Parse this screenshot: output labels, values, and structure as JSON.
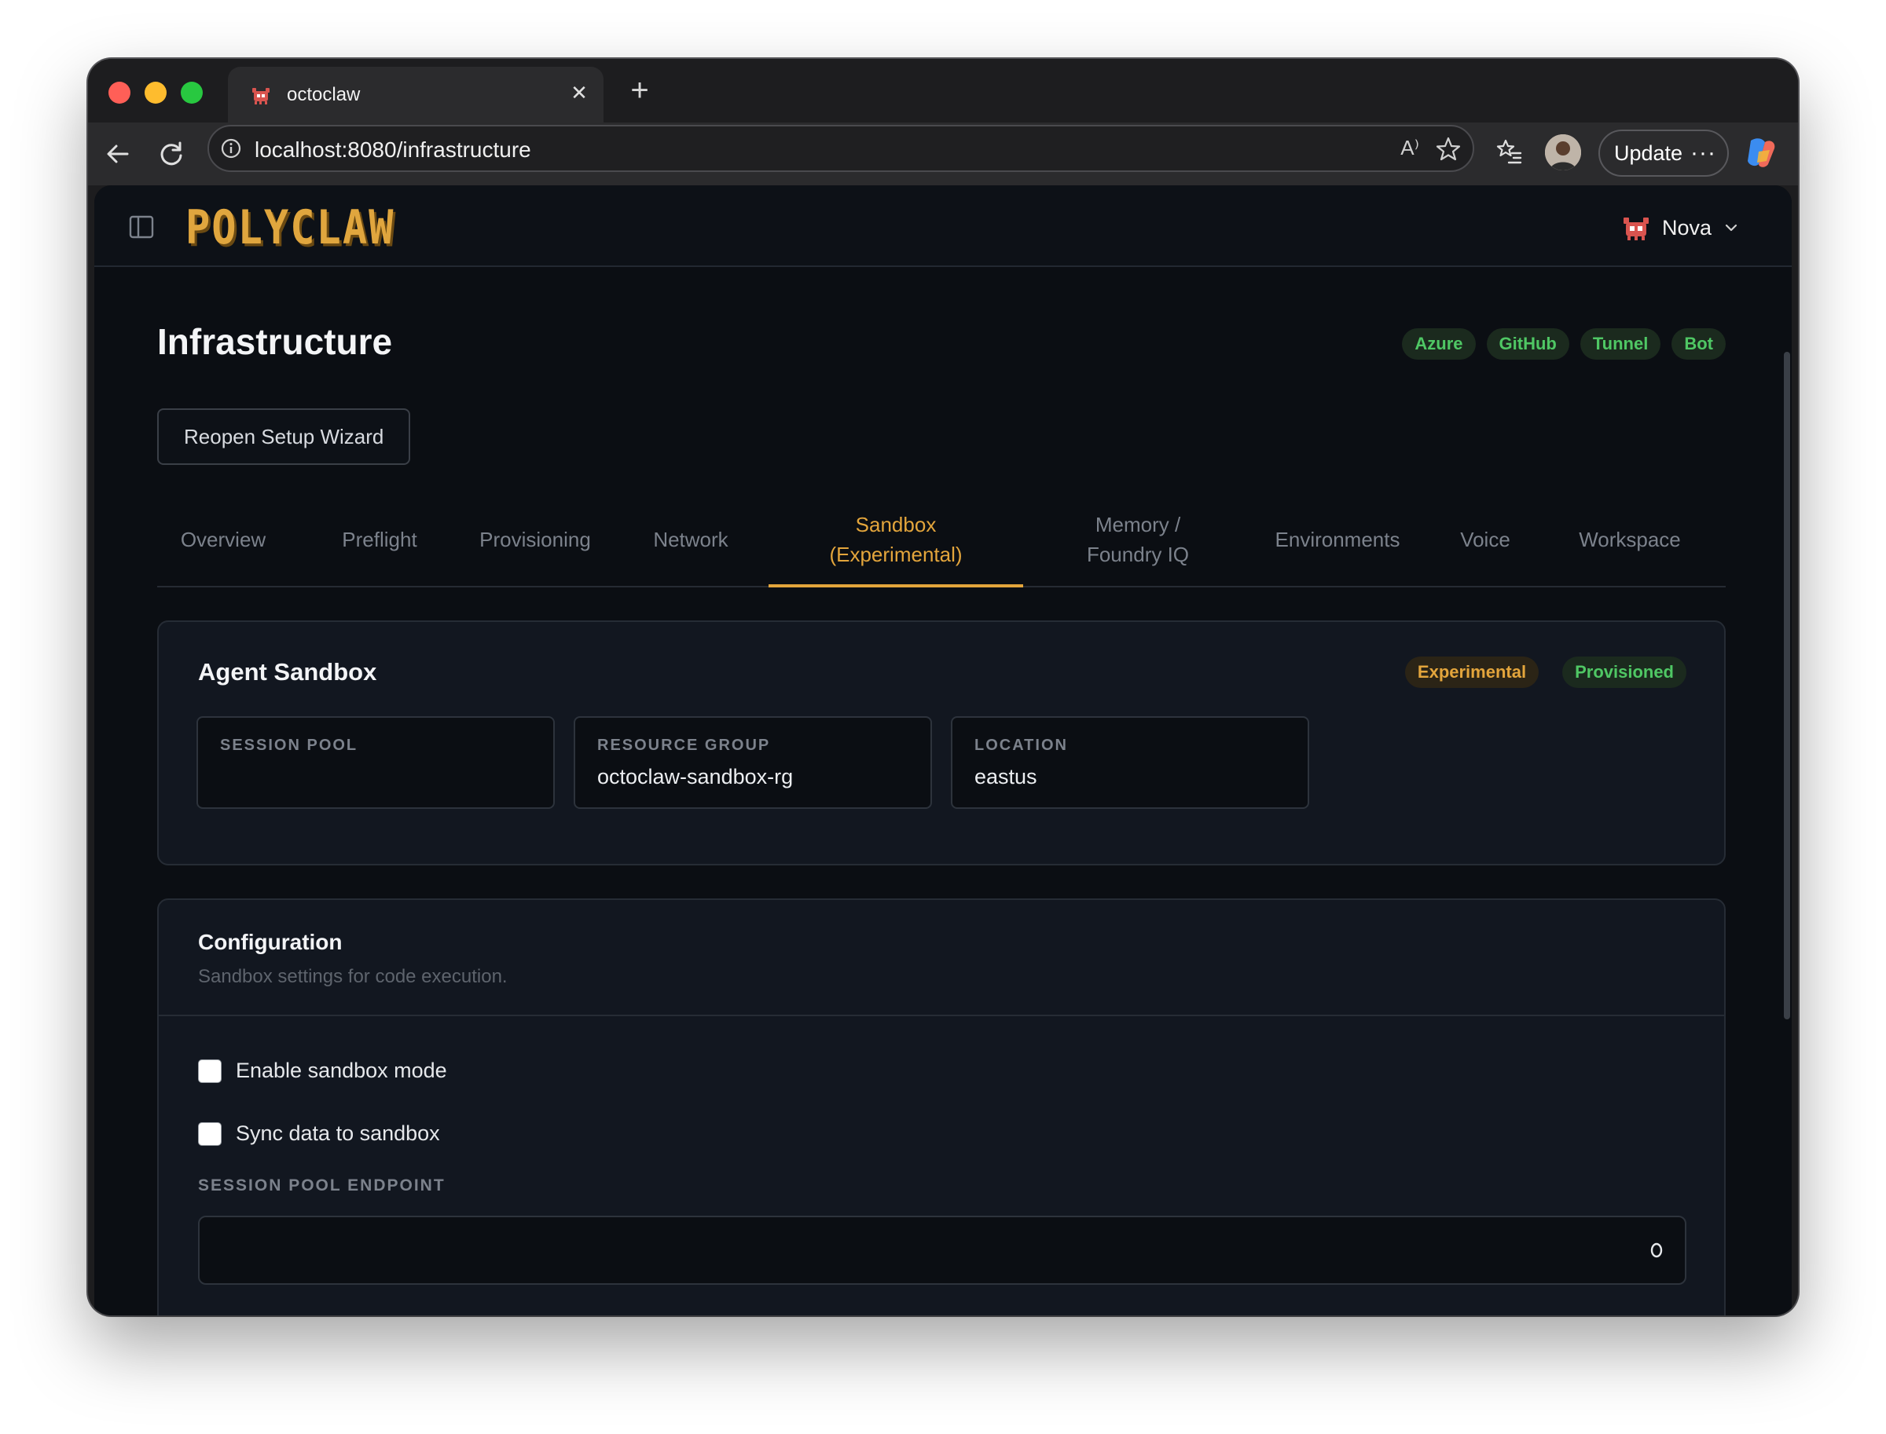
{
  "browser": {
    "tab_title": "octoclaw",
    "url": "localhost:8080/infrastructure",
    "read_aloud": "A⁾",
    "update_label": "Update",
    "update_dots": "···"
  },
  "app": {
    "logo": "POLYCLAW",
    "agent_name": "Nova",
    "accent_color": "#e3a53c",
    "success_color": "#4fc764"
  },
  "page": {
    "title": "Infrastructure",
    "status_badges": [
      "Azure",
      "GitHub",
      "Tunnel",
      "Bot"
    ],
    "reopen_button": "Reopen Setup Wizard"
  },
  "tabs": [
    {
      "label": "Overview"
    },
    {
      "label": "Preflight"
    },
    {
      "label": "Provisioning"
    },
    {
      "label": "Network"
    },
    {
      "label": "Sandbox (Experimental)",
      "active": true
    },
    {
      "label": "Memory / Foundry IQ"
    },
    {
      "label": "Environments"
    },
    {
      "label": "Voice"
    },
    {
      "label": "Workspace"
    }
  ],
  "sandbox_card": {
    "title": "Agent Sandbox",
    "badge_experimental": "Experimental",
    "badge_provisioned": "Provisioned",
    "fields": [
      {
        "label": "SESSION POOL",
        "value": ""
      },
      {
        "label": "RESOURCE GROUP",
        "value": "octoclaw-sandbox-rg"
      },
      {
        "label": "LOCATION",
        "value": "eastus"
      }
    ]
  },
  "config_card": {
    "title": "Configuration",
    "subtitle": "Sandbox settings for code execution.",
    "enable_sandbox_label": "Enable sandbox mode",
    "enable_sandbox_checked": false,
    "sync_data_label": "Sync data to sandbox",
    "sync_data_checked": false,
    "endpoint_label": "SESSION POOL ENDPOINT",
    "endpoint_value": ""
  }
}
